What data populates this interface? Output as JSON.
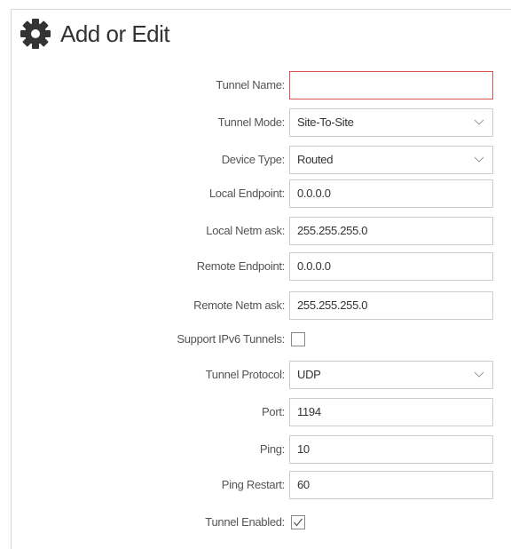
{
  "header": {
    "title": "Add or Edit",
    "icon": "gear-icon"
  },
  "form": {
    "tunnel_name": {
      "label": "Tunnel Name:",
      "value": ""
    },
    "tunnel_mode": {
      "label": "Tunnel Mode:",
      "value": "Site-To-Site"
    },
    "device_type": {
      "label": "Device Type:",
      "value": "Routed"
    },
    "local_endpoint": {
      "label": "Local Endpoint:",
      "value": "0.0.0.0"
    },
    "local_netmask": {
      "label": "Local Netm ask:",
      "value": "255.255.255.0"
    },
    "remote_endpoint": {
      "label": "Remote Endpoint:",
      "value": "0.0.0.0"
    },
    "remote_netmask": {
      "label": "Remote Netm ask:",
      "value": "255.255.255.0"
    },
    "support_ipv6": {
      "label": "Support IPv6 Tunnels:",
      "checked": false
    },
    "tunnel_protocol": {
      "label": "Tunnel Protocol:",
      "value": "UDP"
    },
    "port": {
      "label": "Port:",
      "value": "1194"
    },
    "ping": {
      "label": "Ping:",
      "value": "10"
    },
    "ping_restart": {
      "label": "Ping Restart:",
      "value": "60"
    },
    "tunnel_enabled": {
      "label": "Tunnel Enabled:",
      "checked": true
    }
  },
  "colors": {
    "error_border": "#d9534f",
    "border": "#cccccc",
    "label": "#555555"
  }
}
